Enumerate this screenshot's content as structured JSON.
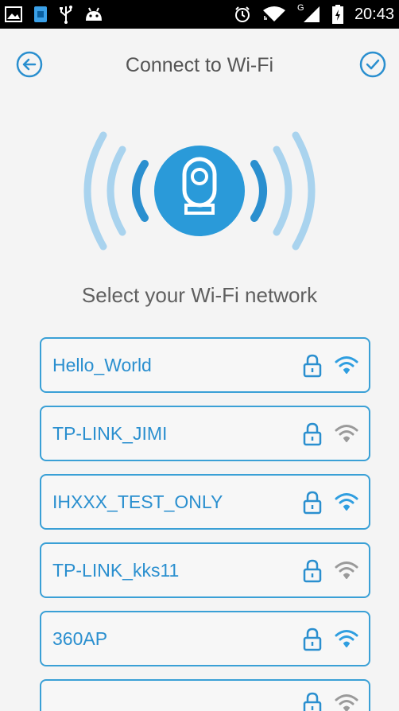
{
  "status_bar": {
    "time": "20:43",
    "network_type": "G",
    "colors": {
      "background": "#000000",
      "foreground": "#ffffff"
    },
    "left_icons": [
      "image-icon",
      "sim-icon",
      "usb-icon",
      "android-icon"
    ],
    "right_icons": [
      "alarm-icon",
      "wifi-icon",
      "signal-icon",
      "battery-icon"
    ]
  },
  "header": {
    "title": "Connect to Wi-Fi",
    "back_icon": "back-arrow-icon",
    "confirm_icon": "check-circle-icon"
  },
  "hero": {
    "icon": "camera-icon"
  },
  "prompt": "Select your Wi-Fi network",
  "networks": [
    {
      "ssid": "Hello_World",
      "secured": true,
      "signal": "strong"
    },
    {
      "ssid": "TP-LINK_JIMI",
      "secured": true,
      "signal": "weak"
    },
    {
      "ssid": "IHXXX_TEST_ONLY",
      "secured": true,
      "signal": "strong"
    },
    {
      "ssid": "TP-LINK_kks11",
      "secured": true,
      "signal": "weak"
    },
    {
      "ssid": "360AP",
      "secured": true,
      "signal": "strong"
    },
    {
      "ssid": "",
      "secured": true,
      "signal": "weak"
    }
  ],
  "colors": {
    "accent": "#2a8fcf",
    "border": "#3aa0d6",
    "wave_light": "#a9d3ee",
    "signal_strong": "#2f9ee0",
    "signal_weak": "#9a9a9a",
    "background": "#f4f4f4"
  }
}
